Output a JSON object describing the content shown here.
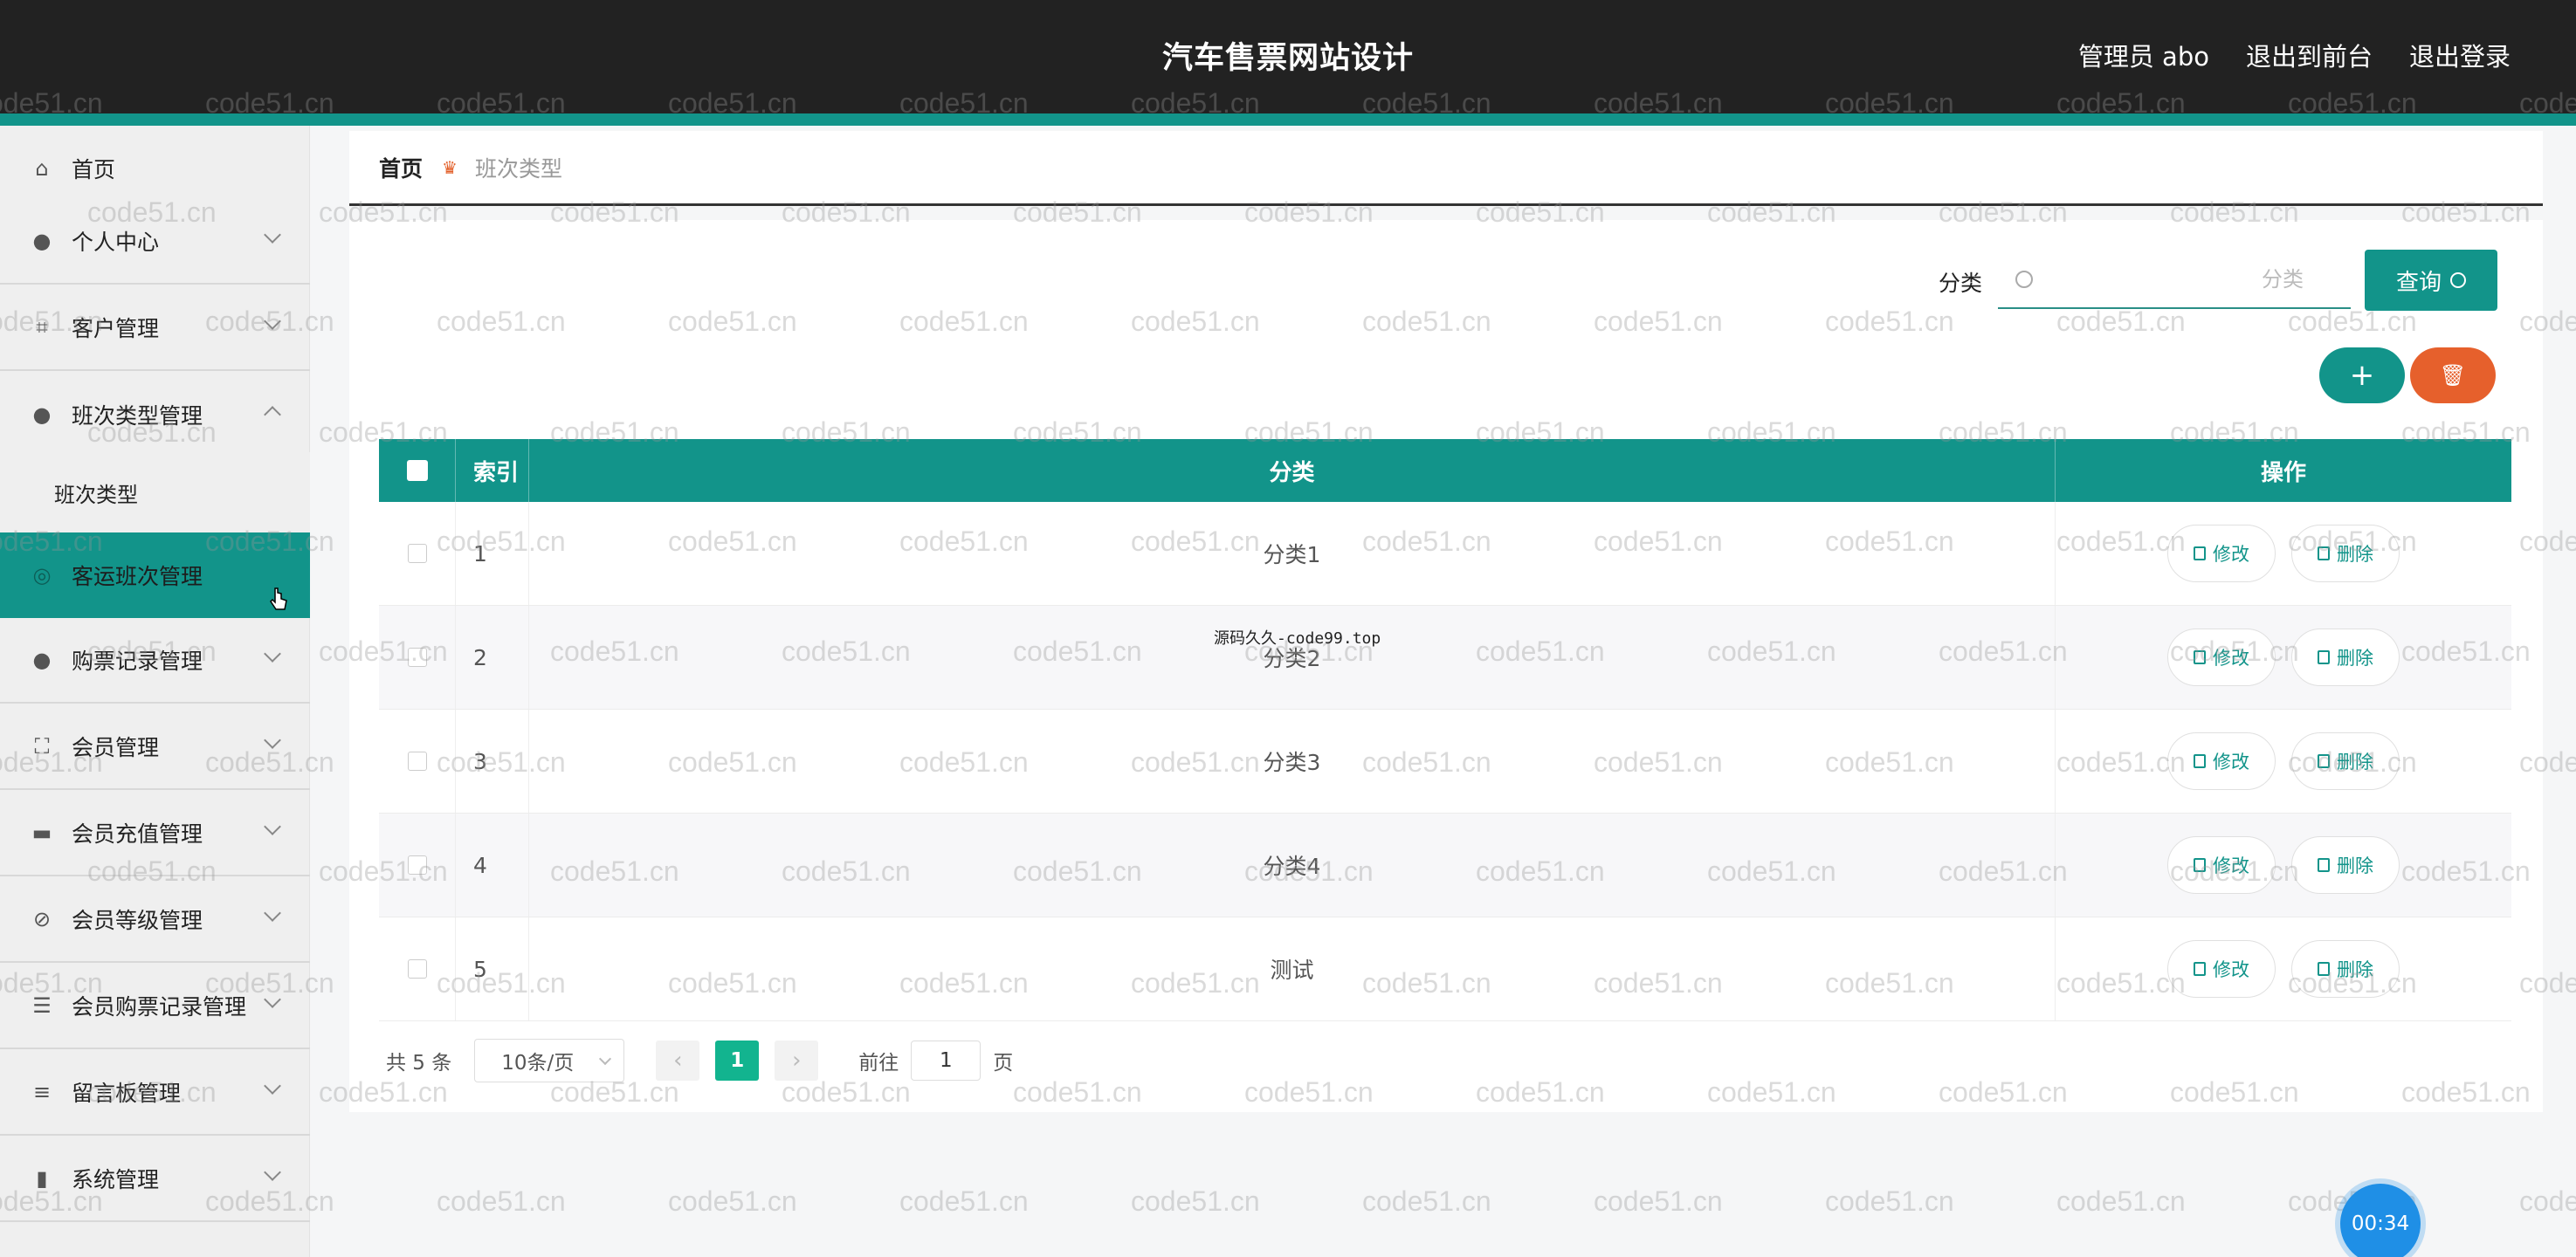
{
  "header": {
    "title": "汽车售票网站设计",
    "admin": "管理员 abo",
    "to_front": "退出到前台",
    "logout": "退出登录"
  },
  "sidebar": {
    "items": [
      {
        "label": "首页",
        "icon": "home-icon"
      },
      {
        "label": "个人中心",
        "icon": "user-icon"
      },
      {
        "label": "客户管理",
        "icon": "crop-icon"
      },
      {
        "label": "班次类型管理",
        "icon": "users-icon"
      },
      {
        "label": "客运班次管理",
        "icon": "compass-icon"
      },
      {
        "label": "购票记录管理",
        "icon": "bulb-icon"
      },
      {
        "label": "会员管理",
        "icon": "frame-icon"
      },
      {
        "label": "会员充值管理",
        "icon": "ticket-icon"
      },
      {
        "label": "会员等级管理",
        "icon": "bell-off-icon"
      },
      {
        "label": "会员购票记录管理",
        "icon": "list-icon"
      },
      {
        "label": "留言板管理",
        "icon": "sliders-icon"
      },
      {
        "label": "系统管理",
        "icon": "chart-icon"
      }
    ],
    "submenu": {
      "label": "班次类型"
    }
  },
  "breadcrumb": {
    "home": "首页",
    "current": "班次类型"
  },
  "search": {
    "label": "分类",
    "placeholder": "分类",
    "button": "查询"
  },
  "actions": {
    "add": "+",
    "delete": "🗑"
  },
  "table": {
    "headers": {
      "index": "索引",
      "category": "分类",
      "ops": "操作"
    },
    "rows": [
      {
        "index": "1",
        "category": "分类1"
      },
      {
        "index": "2",
        "category": "分类2"
      },
      {
        "index": "3",
        "category": "分类3"
      },
      {
        "index": "4",
        "category": "分类4"
      },
      {
        "index": "5",
        "category": "测试"
      }
    ],
    "edit_label": "修改",
    "delete_label": "删除"
  },
  "pagination": {
    "total": "共 5 条",
    "page_size": "10条/页",
    "current_page": "1",
    "goto_prefix": "前往",
    "goto_value": "1",
    "goto_suffix": "页"
  },
  "watermark": {
    "text": "code51.cn",
    "center_text": "源码久久-code99.top"
  },
  "timer": "00:34",
  "colors": {
    "accent": "#12948a",
    "danger": "#e6602c",
    "header_bg": "#222222"
  }
}
